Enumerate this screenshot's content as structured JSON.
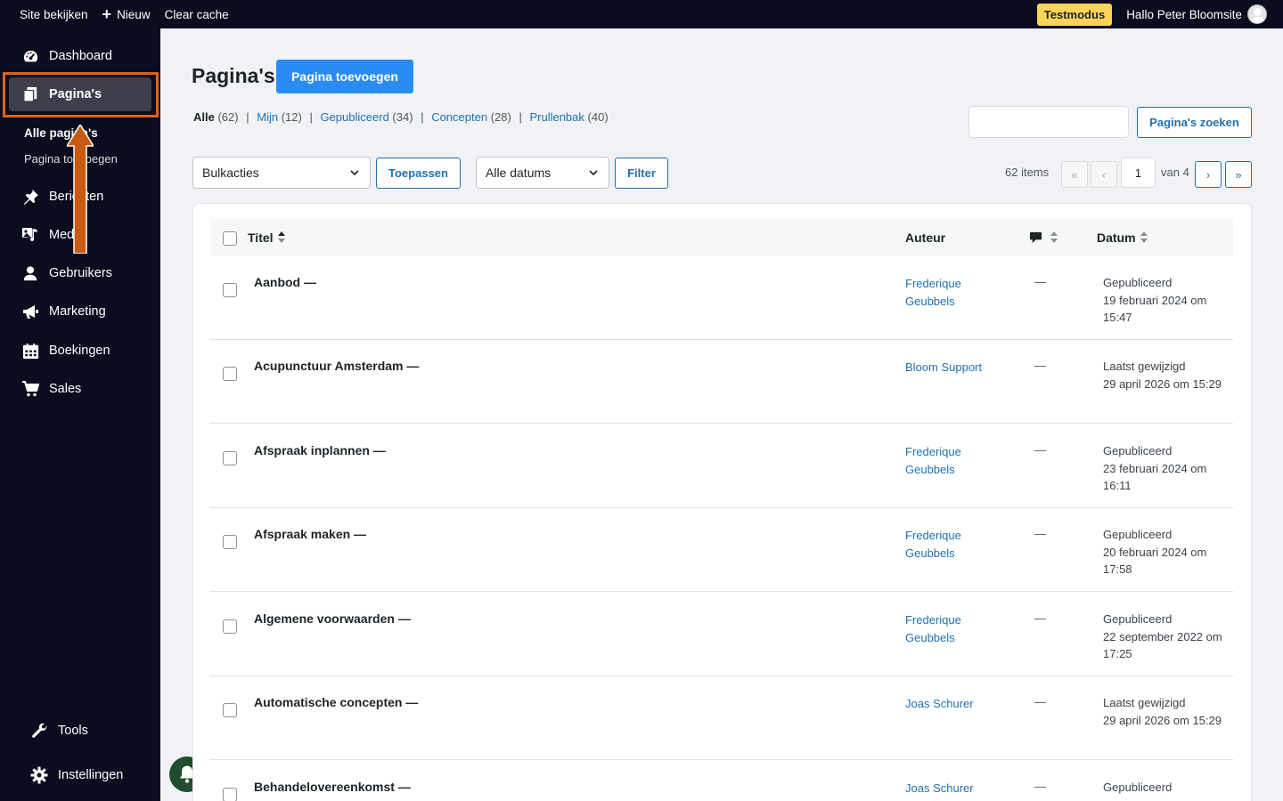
{
  "adminbar": {
    "view_site": "Site bekijken",
    "new": "Nieuw",
    "clear_cache": "Clear cache",
    "test_mode": "Testmodus",
    "greeting": "Hallo Peter Bloomsite"
  },
  "sidebar": {
    "dashboard": "Dashboard",
    "pages": "Pagina's",
    "all_pages": "Alle pagina's",
    "add_page": "Pagina toevoegen",
    "posts": "Berichten",
    "media": "Media",
    "users": "Gebruikers",
    "marketing": "Marketing",
    "bookings": "Boekingen",
    "sales": "Sales",
    "tools": "Tools",
    "settings": "Instellingen"
  },
  "main": {
    "title": "Pagina's",
    "add_button": "Pagina toevoegen",
    "filters": {
      "all": "Alle",
      "all_count": "(62)",
      "mine": "Mijn",
      "mine_count": "(12)",
      "published": "Gepubliceerd",
      "published_count": "(34)",
      "drafts": "Concepten",
      "drafts_count": "(28)",
      "trash": "Prullenbak",
      "trash_count": "(40)"
    },
    "search_placeholder": "",
    "search_button": "Pagina's zoeken",
    "bulk_select": "Bulkacties",
    "apply_button": "Toepassen",
    "date_select": "Alle datums",
    "filter_button": "Filter",
    "pagination": {
      "items": "62 items",
      "first": "«",
      "prev": "‹",
      "current": "1",
      "of": "van 4",
      "next": "›",
      "last": "»"
    },
    "columns": {
      "title": "Titel",
      "author": "Auteur",
      "date": "Datum"
    },
    "rows": [
      {
        "title": "Aanbod —",
        "author": "Frederique Geubbels",
        "comments": "—",
        "status": "Gepubliceerd",
        "date": "19 februari 2024 om 15:47"
      },
      {
        "title": "Acupunctuur Amsterdam —",
        "author": "Bloom Support",
        "comments": "—",
        "status": "Laatst gewijzigd",
        "date": "29 april 2026 om 15:29"
      },
      {
        "title": "Afspraak inplannen —",
        "author": "Frederique Geubbels",
        "comments": "—",
        "status": "Gepubliceerd",
        "date": "23 februari 2024 om 16:11"
      },
      {
        "title": "Afspraak maken —",
        "author": "Frederique Geubbels",
        "comments": "—",
        "status": "Gepubliceerd",
        "date": "20 februari 2024 om 17:58"
      },
      {
        "title": "Algemene voorwaarden —",
        "author": "Frederique Geubbels",
        "comments": "—",
        "status": "Gepubliceerd",
        "date": "22 september 2022 om 17:25"
      },
      {
        "title": "Automatische concepten —",
        "author": "Joas Schurer",
        "comments": "—",
        "status": "Laatst gewijzigd",
        "date": "29 april 2026 om 15:29"
      },
      {
        "title": "Behandelovereenkomst —",
        "author": "Joas Schurer",
        "comments": "—",
        "status": "Gepubliceerd",
        "date": ""
      }
    ]
  },
  "colors": {
    "sidebar_bg": "#0b0d1f",
    "primary": "#2a8cf2",
    "link": "#2271b1",
    "highlight": "#d9641b",
    "test_badge": "#fbd45b"
  },
  "icons": [
    "plus-icon",
    "avatar-icon",
    "dashboard-icon",
    "pages-icon",
    "pin-icon",
    "media-icon",
    "users-icon",
    "megaphone-icon",
    "calendar-icon",
    "cart-icon",
    "wrench-icon",
    "gear-icon",
    "bell-icon",
    "comment-icon",
    "chevron-down-icon",
    "sort-icon"
  ]
}
